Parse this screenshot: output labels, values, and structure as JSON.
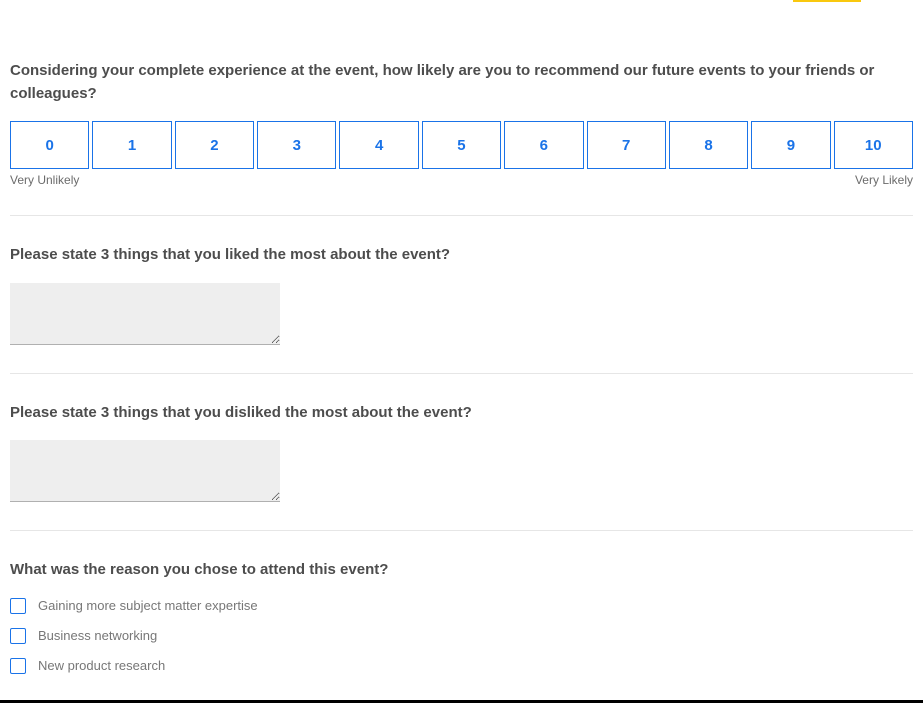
{
  "q1": {
    "prompt": "Considering your complete experience at the event, how likely are you to recommend our future events to your friends or colleagues?",
    "scale": [
      "0",
      "1",
      "2",
      "3",
      "4",
      "5",
      "6",
      "7",
      "8",
      "9",
      "10"
    ],
    "anchor_low": "Very Unlikely",
    "anchor_high": "Very Likely"
  },
  "q2": {
    "prompt": "Please state 3 things that you liked the most about the event?",
    "value": ""
  },
  "q3": {
    "prompt": "Please state 3 things that you disliked the most about the event?",
    "value": ""
  },
  "q4": {
    "prompt": "What was the reason you chose to attend this event?",
    "options": [
      {
        "label": "Gaining more subject matter expertise",
        "checked": false
      },
      {
        "label": "Business networking",
        "checked": false
      },
      {
        "label": "New product research",
        "checked": false
      }
    ]
  }
}
